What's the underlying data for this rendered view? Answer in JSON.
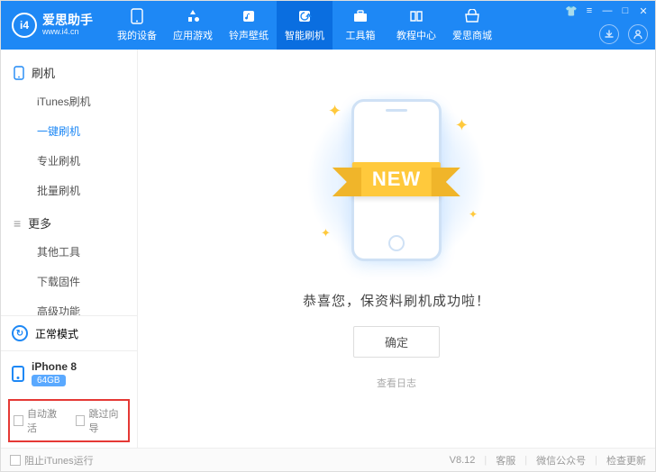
{
  "logo": {
    "glyph": "i4",
    "title": "爱思助手",
    "url": "www.i4.cn"
  },
  "tabs": [
    {
      "label": "我的设备"
    },
    {
      "label": "应用游戏"
    },
    {
      "label": "铃声壁纸"
    },
    {
      "label": "智能刷机"
    },
    {
      "label": "工具箱"
    },
    {
      "label": "教程中心"
    },
    {
      "label": "爱思商城"
    }
  ],
  "active_tab": 3,
  "sidebar": {
    "group1": {
      "title": "刷机",
      "items": [
        "iTunes刷机",
        "一键刷机",
        "专业刷机",
        "批量刷机"
      ],
      "active": 1
    },
    "group2": {
      "title": "更多",
      "items": [
        "其他工具",
        "下载固件",
        "高级功能"
      ]
    }
  },
  "mode": {
    "label": "正常模式"
  },
  "device": {
    "name": "iPhone 8",
    "storage": "64GB"
  },
  "options": {
    "auto_activate": "自动激活",
    "skip_guide": "跳过向导"
  },
  "main": {
    "ribbon": "NEW",
    "message": "恭喜您，保资料刷机成功啦！",
    "ok": "确定",
    "log": "查看日志"
  },
  "footer": {
    "block_itunes": "阻止iTunes运行",
    "version": "V8.12",
    "support": "客服",
    "wechat": "微信公众号",
    "update": "检查更新"
  }
}
